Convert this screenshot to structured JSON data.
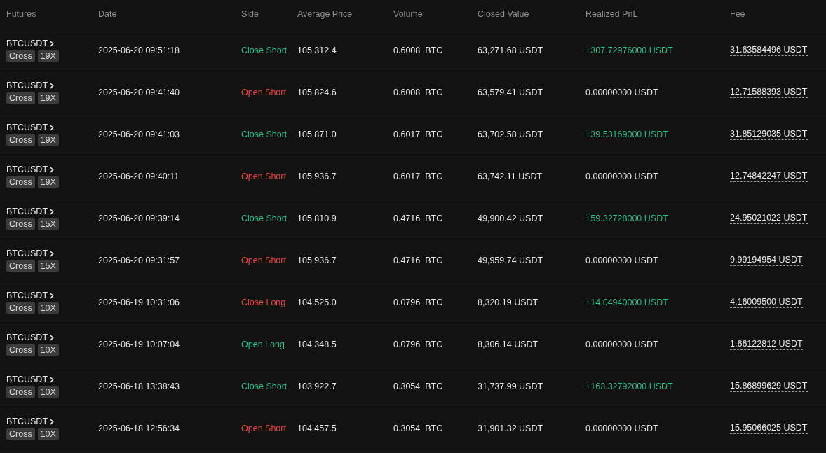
{
  "table": {
    "columns": [
      "Futures",
      "Date",
      "Side",
      "Average Price",
      "Volume",
      "Closed Value",
      "Realized PnL",
      "Fee"
    ],
    "rows": [
      {
        "symbol": "BTCUSDT",
        "margin_mode": "Cross",
        "leverage": "19X",
        "date": "2025-06-20 09:51:18",
        "side": {
          "text": "Close Short",
          "color": "#2ebd85"
        },
        "average_price": "105,312.4",
        "volume": "0.6008",
        "volume_unit": "BTC",
        "closed_value": "63,271.68 USDT",
        "realized_pnl": {
          "text": "+307.72976000 USDT",
          "color": "#2ebd85"
        },
        "fee": "31.63584496 USDT"
      },
      {
        "symbol": "BTCUSDT",
        "margin_mode": "Cross",
        "leverage": "19X",
        "date": "2025-06-20 09:41:40",
        "side": {
          "text": "Open Short",
          "color": "#e5493f"
        },
        "average_price": "105,824.6",
        "volume": "0.6008",
        "volume_unit": "BTC",
        "closed_value": "63,579.41 USDT",
        "realized_pnl": {
          "text": "0.00000000 USDT",
          "color": "#eaeaea"
        },
        "fee": "12.71588393 USDT"
      },
      {
        "symbol": "BTCUSDT",
        "margin_mode": "Cross",
        "leverage": "19X",
        "date": "2025-06-20 09:41:03",
        "side": {
          "text": "Close Short",
          "color": "#2ebd85"
        },
        "average_price": "105,871.0",
        "volume": "0.6017",
        "volume_unit": "BTC",
        "closed_value": "63,702.58 USDT",
        "realized_pnl": {
          "text": "+39.53169000 USDT",
          "color": "#2ebd85"
        },
        "fee": "31.85129035 USDT"
      },
      {
        "symbol": "BTCUSDT",
        "margin_mode": "Cross",
        "leverage": "19X",
        "date": "2025-06-20 09:40:11",
        "side": {
          "text": "Open Short",
          "color": "#e5493f"
        },
        "average_price": "105,936.7",
        "volume": "0.6017",
        "volume_unit": "BTC",
        "closed_value": "63,742.11 USDT",
        "realized_pnl": {
          "text": "0.00000000 USDT",
          "color": "#eaeaea"
        },
        "fee": "12.74842247 USDT"
      },
      {
        "symbol": "BTCUSDT",
        "margin_mode": "Cross",
        "leverage": "15X",
        "date": "2025-06-20 09:39:14",
        "side": {
          "text": "Close Short",
          "color": "#2ebd85"
        },
        "average_price": "105,810.9",
        "volume": "0.4716",
        "volume_unit": "BTC",
        "closed_value": "49,900.42 USDT",
        "realized_pnl": {
          "text": "+59.32728000 USDT",
          "color": "#2ebd85"
        },
        "fee": "24.95021022 USDT"
      },
      {
        "symbol": "BTCUSDT",
        "margin_mode": "Cross",
        "leverage": "15X",
        "date": "2025-06-20 09:31:57",
        "side": {
          "text": "Open Short",
          "color": "#e5493f"
        },
        "average_price": "105,936.7",
        "volume": "0.4716",
        "volume_unit": "BTC",
        "closed_value": "49,959.74 USDT",
        "realized_pnl": {
          "text": "0.00000000 USDT",
          "color": "#eaeaea"
        },
        "fee": "9.99194954 USDT"
      },
      {
        "symbol": "BTCUSDT",
        "margin_mode": "Cross",
        "leverage": "10X",
        "date": "2025-06-19 10:31:06",
        "side": {
          "text": "Close Long",
          "color": "#e5493f"
        },
        "average_price": "104,525.0",
        "volume": "0.0796",
        "volume_unit": "BTC",
        "closed_value": "8,320.19 USDT",
        "realized_pnl": {
          "text": "+14.04940000 USDT",
          "color": "#2ebd85"
        },
        "fee": "4.16009500 USDT"
      },
      {
        "symbol": "BTCUSDT",
        "margin_mode": "Cross",
        "leverage": "10X",
        "date": "2025-06-19 10:07:04",
        "side": {
          "text": "Open Long",
          "color": "#2ebd85"
        },
        "average_price": "104,348.5",
        "volume": "0.0796",
        "volume_unit": "BTC",
        "closed_value": "8,306.14 USDT",
        "realized_pnl": {
          "text": "0.00000000 USDT",
          "color": "#eaeaea"
        },
        "fee": "1.66122812 USDT"
      },
      {
        "symbol": "BTCUSDT",
        "margin_mode": "Cross",
        "leverage": "10X",
        "date": "2025-06-18 13:38:43",
        "side": {
          "text": "Close Short",
          "color": "#2ebd85"
        },
        "average_price": "103,922.7",
        "volume": "0.3054",
        "volume_unit": "BTC",
        "closed_value": "31,737.99 USDT",
        "realized_pnl": {
          "text": "+163.32792000 USDT",
          "color": "#2ebd85"
        },
        "fee": "15.86899629 USDT"
      },
      {
        "symbol": "BTCUSDT",
        "margin_mode": "Cross",
        "leverage": "10X",
        "date": "2025-06-18 12:56:34",
        "side": {
          "text": "Open Short",
          "color": "#e5493f"
        },
        "average_price": "104,457.5",
        "volume": "0.3054",
        "volume_unit": "BTC",
        "closed_value": "31,901.32 USDT",
        "realized_pnl": {
          "text": "0.00000000 USDT",
          "color": "#eaeaea"
        },
        "fee": "15.95066025 USDT"
      }
    ]
  }
}
